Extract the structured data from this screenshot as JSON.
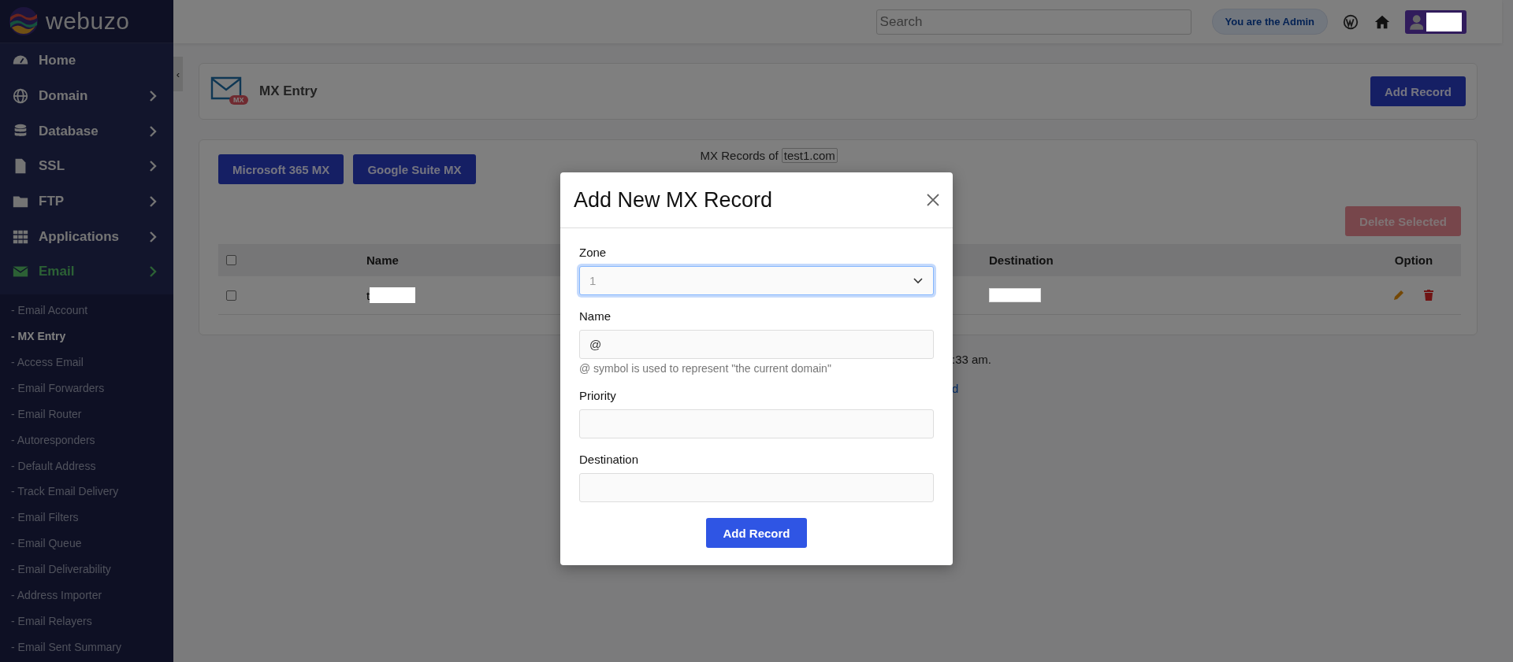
{
  "sidebar": {
    "logo": "webuzo",
    "items": [
      {
        "label": "Home",
        "has_arrow": false,
        "selected": false
      },
      {
        "label": "Domain",
        "has_arrow": true,
        "selected": false
      },
      {
        "label": "Database",
        "has_arrow": true,
        "selected": false
      },
      {
        "label": "SSL",
        "has_arrow": true,
        "selected": false
      },
      {
        "label": "FTP",
        "has_arrow": true,
        "selected": false
      },
      {
        "label": "Applications",
        "has_arrow": true,
        "selected": false
      },
      {
        "label": "Email",
        "has_arrow": true,
        "selected": true
      }
    ],
    "submenu": [
      {
        "label": "- Email Account",
        "selected": false
      },
      {
        "label": "- MX Entry",
        "selected": true
      },
      {
        "label": "- Access Email",
        "selected": false
      },
      {
        "label": "- Email Forwarders",
        "selected": false
      },
      {
        "label": "- Email Router",
        "selected": false
      },
      {
        "label": "- Autoresponders",
        "selected": false
      },
      {
        "label": "- Default Address",
        "selected": false
      },
      {
        "label": "- Track Email Delivery",
        "selected": false
      },
      {
        "label": "- Email Filters",
        "selected": false
      },
      {
        "label": "- Email Queue",
        "selected": false
      },
      {
        "label": "- Email Deliverability",
        "selected": false
      },
      {
        "label": "- Address Importer",
        "selected": false
      },
      {
        "label": "- Email Relayers",
        "selected": false
      },
      {
        "label": "- Email Sent Summary",
        "selected": false
      }
    ]
  },
  "collapse_handle": "‹",
  "topbar": {
    "search": {
      "placeholder": "Search"
    },
    "admin_badge": "You are the Admin"
  },
  "page_header": {
    "title": "MX Entry",
    "icon_badge": "MX",
    "action": "Add Record"
  },
  "records": {
    "preset_buttons": [
      "Microsoft 365 MX",
      "Google Suite MX"
    ],
    "zone_label": "MX Records of",
    "zone_value": "test1.com",
    "delete_button": {
      "label": "Delete Selected",
      "disabled": true
    },
    "select_all_checked": false,
    "columns": [
      "Name",
      "Destination",
      "Option"
    ],
    "rows": [
      {
        "name": "t",
        "checked": false
      }
    ]
  },
  "footer_fragments": [
    {
      "text": ":33 am.",
      "kind": "text"
    },
    {
      "text": "d",
      "kind": "link"
    }
  ],
  "modal": {
    "title": "Add New MX Record",
    "fields": [
      {
        "label": "Zone",
        "kind": "select",
        "value": "1",
        "focused": true
      },
      {
        "label": "Name",
        "kind": "input",
        "value": "@",
        "help": "@ symbol is used to represent \"the current domain\"",
        "focused": false
      },
      {
        "label": "Priority",
        "kind": "input",
        "focused": false
      },
      {
        "label": "Destination",
        "kind": "input",
        "focused": false
      }
    ],
    "submit": "Add Record"
  }
}
